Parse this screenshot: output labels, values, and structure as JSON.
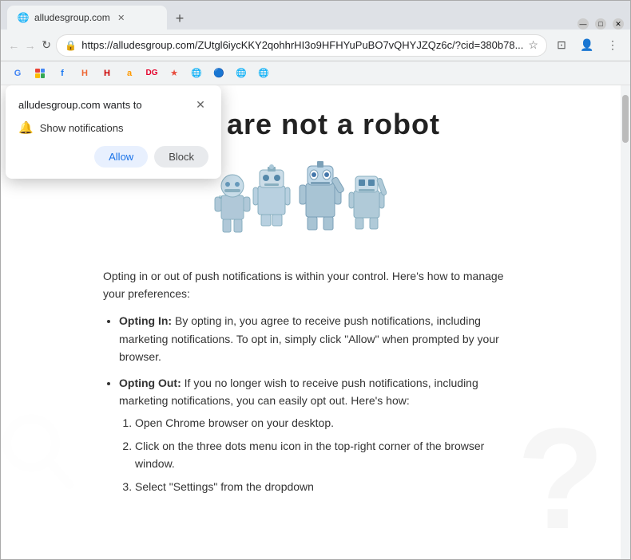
{
  "browser": {
    "url": "https://alludesgroup.com/ZUtgl6iycKKY2qohhrHI3o9HFHYuPuBO7vQHYJZQz6c/?cid=380b78...",
    "tab_title": "alludesgroup.com",
    "tab_favicon": "🌐"
  },
  "bookmarks": [
    {
      "label": "",
      "favicon": "G"
    },
    {
      "label": "",
      "favicon": "MS"
    },
    {
      "label": "",
      "favicon": "F"
    },
    {
      "label": "",
      "favicon": "H"
    },
    {
      "label": "",
      "favicon": "H"
    },
    {
      "label": "",
      "favicon": "a"
    },
    {
      "label": "",
      "favicon": "DG"
    },
    {
      "label": "",
      "favicon": "★"
    },
    {
      "label": "",
      "favicon": "🌐"
    },
    {
      "label": "",
      "favicon": "🌐"
    },
    {
      "label": "",
      "favicon": "🌐"
    }
  ],
  "notification_popup": {
    "title": "alludesgroup.com wants to",
    "notification_label": "Show notifications",
    "allow_button": "Allow",
    "block_button": "Block"
  },
  "page": {
    "hero_text": "ou are not   a robot",
    "intro": "Opting in or out of push notifications is within your control. Here's how to manage your preferences:",
    "list_items": [
      {
        "label": "Opting In:",
        "text": " By opting in, you agree to receive push notifications, including marketing notifications. To opt in, simply click \"Allow\" when prompted by your browser."
      },
      {
        "label": "Opting Out:",
        "text": " If you no longer wish to receive push notifications, including marketing notifications, you can easily opt out. Here's how:"
      }
    ],
    "steps": [
      "Open Chrome browser on your desktop.",
      "Click on the three dots menu icon in the top-right corner of the browser window.",
      "Select \"Settings\" from the dropdown"
    ]
  }
}
